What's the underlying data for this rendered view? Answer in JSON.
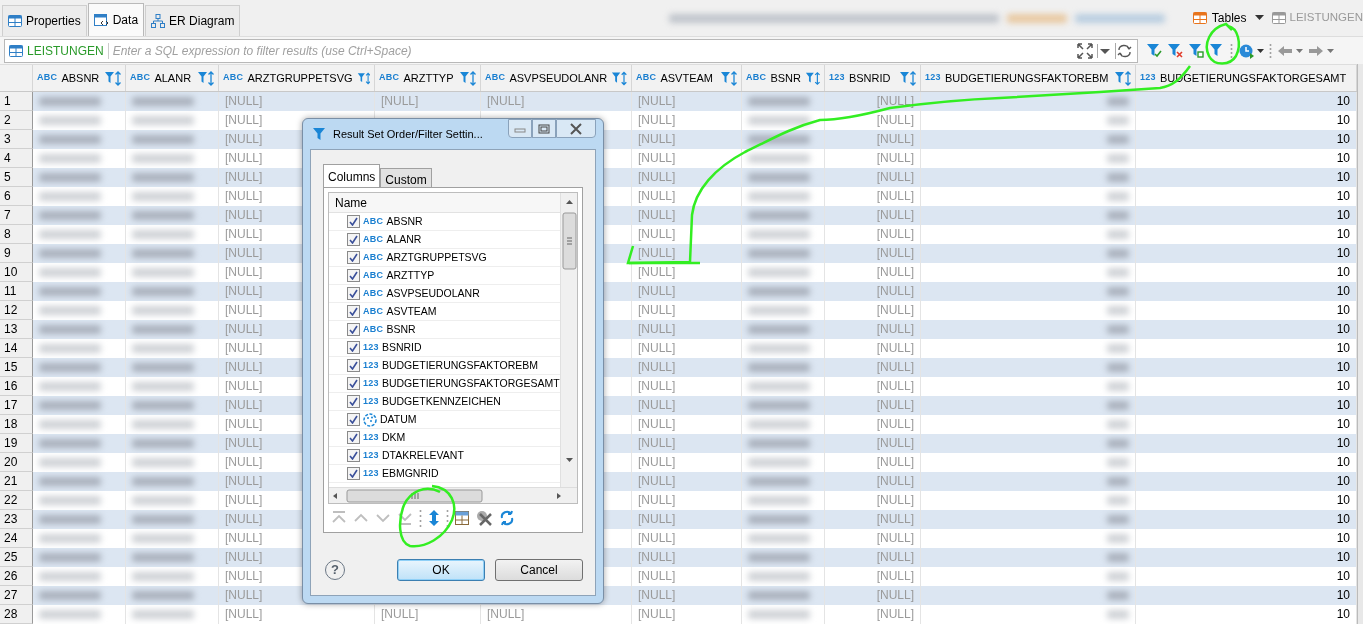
{
  "editor_tabs": [
    {
      "label": "Properties",
      "kind": "properties",
      "selected": false
    },
    {
      "label": "Data",
      "kind": "data",
      "selected": true
    },
    {
      "label": "ER Diagram",
      "kind": "diagram",
      "selected": false
    }
  ],
  "breadcrumb": {
    "tables_label": "Tables",
    "table_label": "LEISTUNGEN"
  },
  "filter_bar": {
    "table_name": "LEISTUNGEN",
    "placeholder": "Enter a SQL expression to filter results (use Ctrl+Space)"
  },
  "grid": {
    "columns": [
      {
        "type_label": "ABC",
        "name": "ABSNR",
        "blurred": true,
        "right_aligned": false,
        "filter_icon": true
      },
      {
        "type_label": "ABC",
        "name": "ALANR",
        "blurred": true,
        "right_aligned": false,
        "filter_icon": true
      },
      {
        "type_label": "ABC",
        "name": "ARZTGRUPPETSVG",
        "blurred": false,
        "right_aligned": false,
        "filter_icon": true
      },
      {
        "type_label": "ABC",
        "name": "ARZTTYP",
        "blurred": false,
        "right_aligned": false,
        "filter_icon": true
      },
      {
        "type_label": "ABC",
        "name": "ASVPSEUDOLANR",
        "blurred": false,
        "right_aligned": false,
        "filter_icon": true
      },
      {
        "type_label": "ABC",
        "name": "ASVTEAM",
        "blurred": false,
        "right_aligned": false,
        "filter_icon": true
      },
      {
        "type_label": "ABC",
        "name": "BSNR",
        "blurred": true,
        "right_aligned": false,
        "filter_icon": true
      },
      {
        "type_label": "123",
        "name": "BSNRID",
        "blurred": false,
        "right_aligned": true,
        "filter_icon": true
      },
      {
        "type_label": "123",
        "name": "BUDGETIERUNGSFAKTOREBM",
        "blurred": true,
        "right_aligned": true,
        "filter_icon": true
      },
      {
        "type_label": "123",
        "name": "BUDGETIERUNGSFAKTORGESAMT",
        "blurred": false,
        "right_aligned": true,
        "filter_icon": false
      }
    ],
    "rows": [
      {
        "number": "1",
        "cells": [
          null,
          null,
          "[NULL]",
          "[NULL]",
          "[NULL]",
          "[NULL]",
          null,
          "[NULL]",
          null,
          "10"
        ]
      },
      {
        "number": "2",
        "cells": [
          null,
          null,
          "[NULL]",
          null,
          null,
          "[NULL]",
          null,
          "[NULL]",
          null,
          "10"
        ]
      },
      {
        "number": "3",
        "cells": [
          null,
          null,
          "[NULL]",
          null,
          null,
          "[NULL]",
          null,
          "[NULL]",
          null,
          "10"
        ]
      },
      {
        "number": "4",
        "cells": [
          null,
          null,
          "[NULL]",
          null,
          null,
          "[NULL]",
          null,
          "[NULL]",
          null,
          "10"
        ]
      },
      {
        "number": "5",
        "cells": [
          null,
          null,
          "[NULL]",
          null,
          null,
          "[NULL]",
          null,
          "[NULL]",
          null,
          "10"
        ]
      },
      {
        "number": "6",
        "cells": [
          null,
          null,
          "[NULL]",
          null,
          null,
          "[NULL]",
          null,
          "[NULL]",
          null,
          "10"
        ]
      },
      {
        "number": "7",
        "cells": [
          null,
          null,
          "[NULL]",
          null,
          null,
          "[NULL]",
          null,
          "[NULL]",
          null,
          "10"
        ]
      },
      {
        "number": "8",
        "cells": [
          null,
          null,
          "[NULL]",
          null,
          null,
          "[NULL]",
          null,
          "[NULL]",
          null,
          "10"
        ]
      },
      {
        "number": "9",
        "cells": [
          null,
          null,
          "[NULL]",
          null,
          null,
          "[NULL]",
          null,
          "[NULL]",
          null,
          "10"
        ]
      },
      {
        "number": "10",
        "cells": [
          null,
          null,
          "[NULL]",
          null,
          null,
          "[NULL]",
          null,
          "[NULL]",
          null,
          "10"
        ]
      },
      {
        "number": "11",
        "cells": [
          null,
          null,
          "[NULL]",
          null,
          null,
          "[NULL]",
          null,
          "[NULL]",
          null,
          "10"
        ]
      },
      {
        "number": "12",
        "cells": [
          null,
          null,
          "[NULL]",
          null,
          null,
          "[NULL]",
          null,
          "[NULL]",
          null,
          "10"
        ]
      },
      {
        "number": "13",
        "cells": [
          null,
          null,
          "[NULL]",
          null,
          null,
          "[NULL]",
          null,
          "[NULL]",
          null,
          "10"
        ]
      },
      {
        "number": "14",
        "cells": [
          null,
          null,
          "[NULL]",
          null,
          null,
          "[NULL]",
          null,
          "[NULL]",
          null,
          "10"
        ]
      },
      {
        "number": "15",
        "cells": [
          null,
          null,
          "[NULL]",
          null,
          null,
          "[NULL]",
          null,
          "[NULL]",
          null,
          "10"
        ]
      },
      {
        "number": "16",
        "cells": [
          null,
          null,
          "[NULL]",
          null,
          null,
          "[NULL]",
          null,
          "[NULL]",
          null,
          "10"
        ]
      },
      {
        "number": "17",
        "cells": [
          null,
          null,
          "[NULL]",
          null,
          null,
          "[NULL]",
          null,
          "[NULL]",
          null,
          "10"
        ]
      },
      {
        "number": "18",
        "cells": [
          null,
          null,
          "[NULL]",
          null,
          null,
          "[NULL]",
          null,
          "[NULL]",
          null,
          "10"
        ]
      },
      {
        "number": "19",
        "cells": [
          null,
          null,
          "[NULL]",
          null,
          null,
          "[NULL]",
          null,
          "[NULL]",
          null,
          "10"
        ]
      },
      {
        "number": "20",
        "cells": [
          null,
          null,
          "[NULL]",
          null,
          null,
          "[NULL]",
          null,
          "[NULL]",
          null,
          "10"
        ]
      },
      {
        "number": "21",
        "cells": [
          null,
          null,
          "[NULL]",
          null,
          null,
          "[NULL]",
          null,
          "[NULL]",
          null,
          "10"
        ]
      },
      {
        "number": "22",
        "cells": [
          null,
          null,
          "[NULL]",
          null,
          null,
          "[NULL]",
          null,
          "[NULL]",
          null,
          "10"
        ]
      },
      {
        "number": "23",
        "cells": [
          null,
          null,
          "[NULL]",
          null,
          null,
          "[NULL]",
          null,
          "[NULL]",
          null,
          "10"
        ]
      },
      {
        "number": "24",
        "cells": [
          null,
          null,
          "[NULL]",
          null,
          null,
          "[NULL]",
          null,
          "[NULL]",
          null,
          "10"
        ]
      },
      {
        "number": "25",
        "cells": [
          null,
          null,
          "[NULL]",
          null,
          null,
          "[NULL]",
          null,
          "[NULL]",
          null,
          "10"
        ]
      },
      {
        "number": "26",
        "cells": [
          null,
          null,
          "[NULL]",
          null,
          null,
          "[NULL]",
          null,
          "[NULL]",
          null,
          "10"
        ]
      },
      {
        "number": "27",
        "cells": [
          null,
          null,
          "[NULL]",
          null,
          null,
          "[NULL]",
          null,
          "[NULL]",
          null,
          "10"
        ]
      },
      {
        "number": "28",
        "cells": [
          null,
          null,
          "[NULL]",
          "[NULL]",
          "[NULL]",
          "[NULL]",
          null,
          "[NULL]",
          null,
          "10"
        ]
      }
    ]
  },
  "dialog": {
    "title": "Result Set Order/Filter Settin...",
    "tabs": [
      {
        "label": "Columns",
        "selected": true
      },
      {
        "label": "Custom",
        "selected": false
      }
    ],
    "list_header": "Name",
    "columns": [
      {
        "kind": "typed",
        "type_label": "ABC",
        "name": "ABSNR",
        "checked": true
      },
      {
        "kind": "typed",
        "type_label": "ABC",
        "name": "ALANR",
        "checked": true
      },
      {
        "kind": "typed",
        "type_label": "ABC",
        "name": "ARZTGRUPPETSVG",
        "checked": true
      },
      {
        "kind": "typed",
        "type_label": "ABC",
        "name": "ARZTTYP",
        "checked": true
      },
      {
        "kind": "typed",
        "type_label": "ABC",
        "name": "ASVPSEUDOLANR",
        "checked": true
      },
      {
        "kind": "typed",
        "type_label": "ABC",
        "name": "ASVTEAM",
        "checked": true
      },
      {
        "kind": "typed",
        "type_label": "ABC",
        "name": "BSNR",
        "checked": true
      },
      {
        "kind": "typed",
        "type_label": "123",
        "name": "BSNRID",
        "checked": true
      },
      {
        "kind": "typed",
        "type_label": "123",
        "name": "BUDGETIERUNGSFAKTOREBM",
        "checked": true
      },
      {
        "kind": "typed",
        "type_label": "123",
        "name": "BUDGETIERUNGSFAKTORGESAMT",
        "checked": true
      },
      {
        "kind": "typed",
        "type_label": "123",
        "name": "BUDGETKENNZEICHEN",
        "checked": true
      },
      {
        "kind": "date",
        "name": "DATUM",
        "checked": true
      },
      {
        "kind": "typed",
        "type_label": "123",
        "name": "DKM",
        "checked": true
      },
      {
        "kind": "typed",
        "type_label": "123",
        "name": "DTAKRELEVANT",
        "checked": true
      },
      {
        "kind": "typed",
        "type_label": "123",
        "name": "EBMGNRID",
        "checked": true
      }
    ],
    "toolbar": [
      {
        "kind": "move-top",
        "disabled": true
      },
      {
        "kind": "move-up",
        "disabled": true
      },
      {
        "kind": "move-down",
        "disabled": true
      },
      {
        "kind": "move-bottom",
        "disabled": true
      },
      {
        "kind": "separator",
        "disabled": false
      },
      {
        "kind": "sort",
        "disabled": false
      },
      {
        "kind": "separator",
        "disabled": false
      },
      {
        "kind": "table",
        "disabled": false
      },
      {
        "kind": "delete",
        "disabled": false
      },
      {
        "kind": "refresh",
        "disabled": false
      }
    ],
    "help_label": "?",
    "buttons": [
      {
        "label": "OK",
        "default": true
      },
      {
        "label": "Cancel",
        "default": false
      }
    ]
  }
}
